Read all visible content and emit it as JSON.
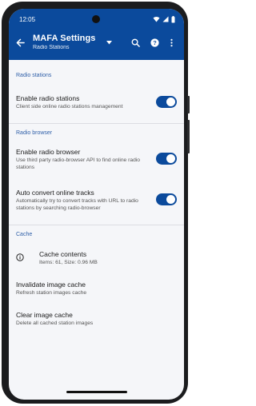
{
  "status": {
    "time": "12:05"
  },
  "appbar": {
    "title": "MAFA Settings",
    "subtitle": "Radio Stations"
  },
  "sections": {
    "radio_stations": "Radio stations",
    "radio_browser": "Radio browser",
    "cache": "Cache"
  },
  "items": {
    "enable_radio": {
      "title": "Enable radio stations",
      "desc": "Client side online radio stations management",
      "enabled": true
    },
    "enable_browser": {
      "title": "Enable radio browser",
      "desc": "Use third party radio-browser API to find online radio stations",
      "enabled": true
    },
    "auto_convert": {
      "title": "Auto convert online tracks",
      "desc": "Automatically try to convert tracks with URL to radio stations by searching radio-browser",
      "enabled": true
    },
    "cache_contents": {
      "title": "Cache contents",
      "desc": "Items: 61, Size: 0.96 MB"
    },
    "invalidate_cache": {
      "title": "Invalidate image cache",
      "desc": "Refresh station images cache"
    },
    "clear_cache": {
      "title": "Clear image cache",
      "desc": "Delete all cached station images"
    }
  },
  "colors": {
    "primary": "#0b4a9c",
    "section": "#2f5fa8",
    "background": "#f5f6f9"
  },
  "icons": [
    "back-arrow-icon",
    "dropdown-arrow-icon",
    "search-icon",
    "help-icon",
    "more-vert-icon",
    "info-icon",
    "wifi-icon",
    "signal-icon",
    "battery-icon"
  ]
}
